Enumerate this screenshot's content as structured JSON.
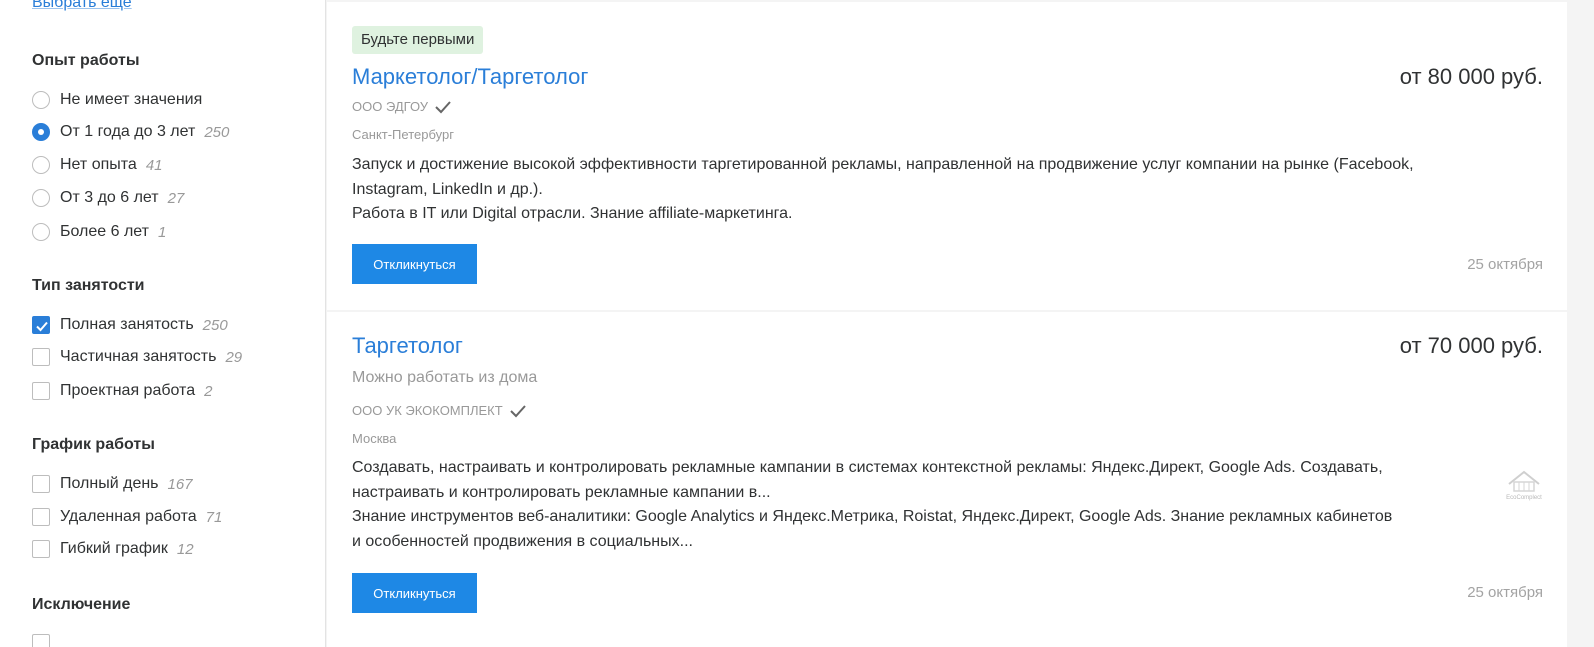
{
  "sidebar": {
    "more_link": "Выбрать еще",
    "experience": {
      "title": "Опыт работы",
      "options": [
        {
          "label": "Не имеет значения",
          "count": "",
          "selected": false
        },
        {
          "label": "От 1 года до 3 лет",
          "count": "250",
          "selected": true
        },
        {
          "label": "Нет опыта",
          "count": "41",
          "selected": false
        },
        {
          "label": "От 3 до 6 лет",
          "count": "27",
          "selected": false
        },
        {
          "label": "Более 6 лет",
          "count": "1",
          "selected": false
        }
      ]
    },
    "employment": {
      "title": "Тип занятости",
      "options": [
        {
          "label": "Полная занятость",
          "count": "250",
          "checked": true
        },
        {
          "label": "Частичная занятость",
          "count": "29",
          "checked": false
        },
        {
          "label": "Проектная работа",
          "count": "2",
          "checked": false
        }
      ]
    },
    "schedule": {
      "title": "График работы",
      "options": [
        {
          "label": "Полный день",
          "count": "167",
          "checked": false
        },
        {
          "label": "Удаленная работа",
          "count": "71",
          "checked": false
        },
        {
          "label": "Гибкий график",
          "count": "12",
          "checked": false
        }
      ]
    },
    "exclusion": {
      "title": "Исключение"
    }
  },
  "vacancies": [
    {
      "badge": "Будьте первыми",
      "title": "Маркетолог/Таргетолог",
      "salary": "от 80 000 руб.",
      "company": "ООО ЭДГОУ",
      "city": "Санкт-Петербург",
      "desc_line1": "Запуск и достижение высокой эффективности таргетированной рекламы, направленной на продвижение услуг компании на рынке (Facebook,",
      "desc_line2": "Instagram, LinkedIn и др.).",
      "desc_line3": "Работа в IT или Digital отрасли. Знание affiliate-маркетинга.",
      "button": "Откликнуться",
      "date": "25 октября"
    },
    {
      "title": "Таргетолог",
      "remote": "Можно работать из дома",
      "salary": "от 70 000 руб.",
      "company": "ООО УК ЭКОКОМПЛЕКТ",
      "city": "Москва",
      "desc_line1": "Создавать, настраивать и контролировать рекламные кампании в системах контекстной рекламы: Яндекс.Директ, Google Ads. Создавать,",
      "desc_line2": "настраивать и контролировать рекламные кампании в...",
      "desc_line3": "Знание инструментов веб-аналитики: Google Analytics и Яндекс.Метрика, Roistat, Яндекс.Директ, Google Ads. Знание рекламных кабинетов",
      "desc_line4": "и особенностей продвижения в социальных...",
      "button": "Откликнуться",
      "date": "25 октября",
      "logo_text": "EcoComplect"
    }
  ],
  "colors": {
    "accent": "#2a7ed8",
    "button": "#1e88e5",
    "badge_bg": "#dff2e0"
  }
}
